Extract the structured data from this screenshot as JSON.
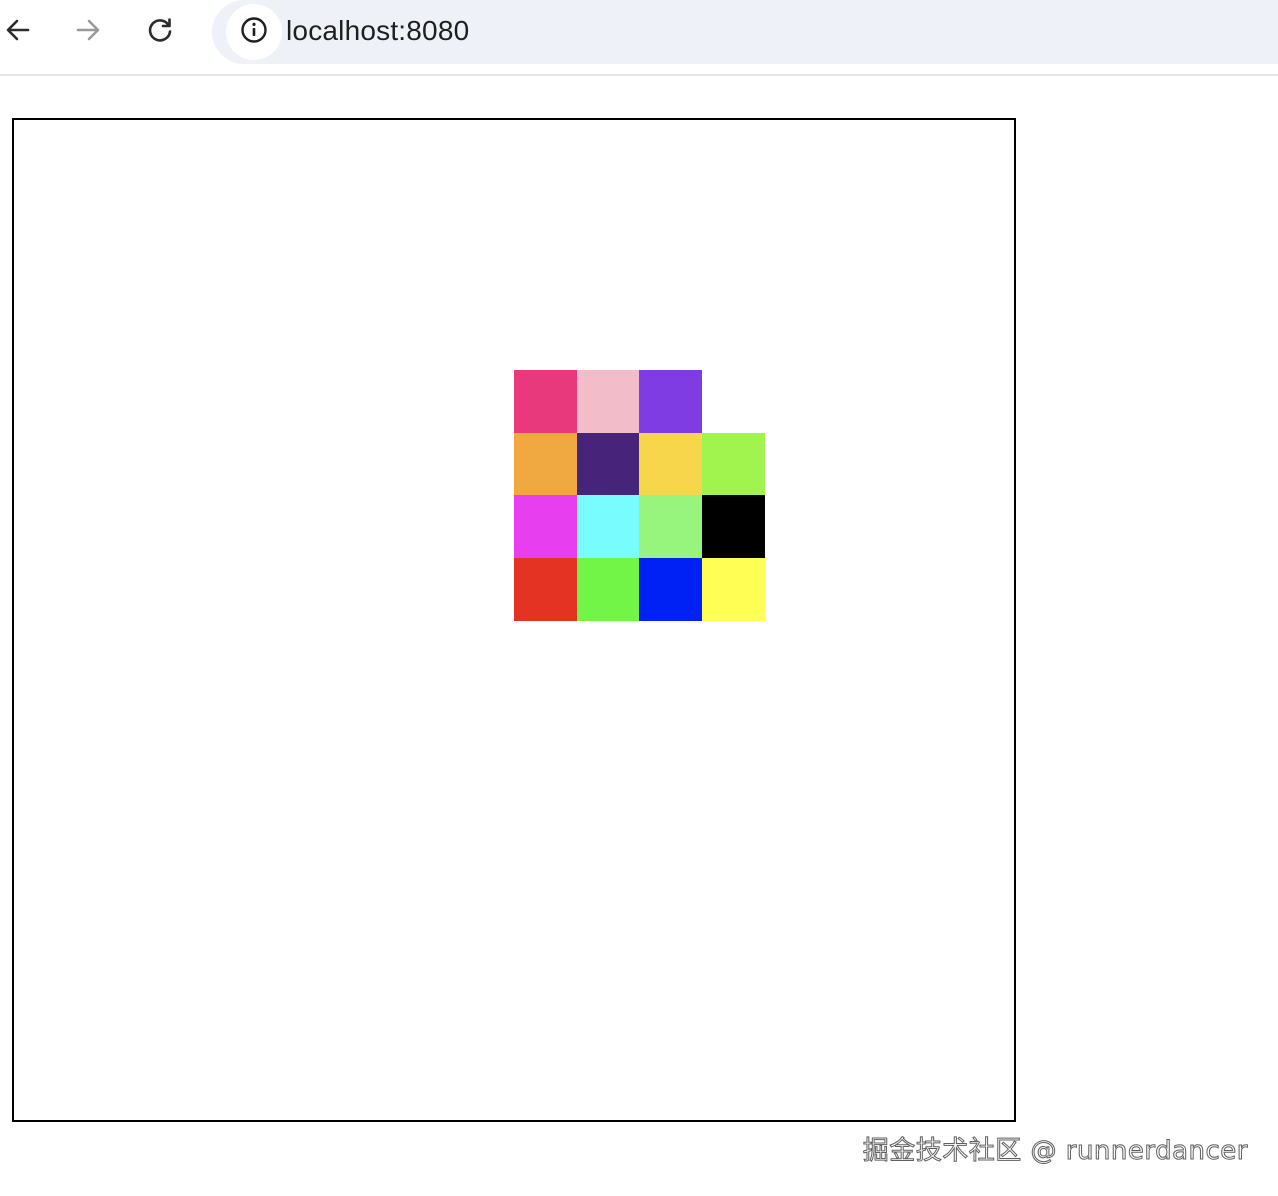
{
  "browser": {
    "url": "localhost:8080",
    "back_icon": "arrow-left-icon",
    "forward_icon": "arrow-right-icon",
    "reload_icon": "reload-icon",
    "site_info_icon": "info-icon",
    "forward_enabled": false
  },
  "tiles": {
    "rows": [
      [
        "#e8397d",
        "#f2bcc8",
        "#7f3ce2",
        null
      ],
      [
        "#f0a841",
        "#47237a",
        "#f7d64c",
        "#a1f44e"
      ],
      [
        "#e73ef0",
        "#78fcfd",
        "#97f57e",
        "#000000"
      ],
      [
        "#e53323",
        "#73f547",
        "#0021f5",
        "#fefe55"
      ]
    ]
  },
  "watermark": {
    "text": "掘金技术社区 @ runnerdancer"
  }
}
